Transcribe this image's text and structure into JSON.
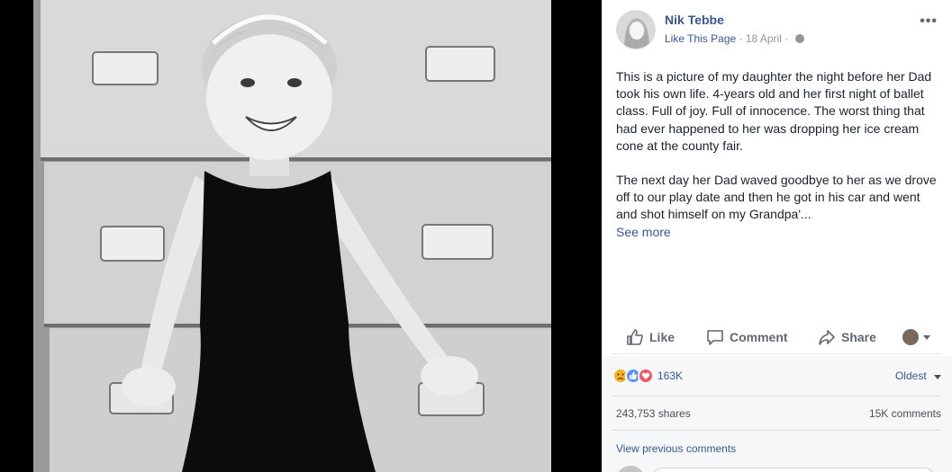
{
  "post": {
    "author": "Nik Tebbe",
    "like_page_label": "Like This Page",
    "separator": "·",
    "date": "18 April",
    "separator2": "·",
    "more_label": "•••",
    "paragraph1": "This is a picture of my daughter the night before her Dad took his own life. 4-years old and her first night of ballet class. Full of joy. Full of innocence. The worst thing that had ever happened to her was dropping her ice cream cone at the county fair.",
    "paragraph2": "The next day her Dad waved goodbye to her as we drove off to our play date and then he got in his car and went and shot himself on my Grandpa'...",
    "see_more": "See more"
  },
  "actions": {
    "like": "Like",
    "comment": "Comment",
    "share": "Share"
  },
  "stats": {
    "reaction_count": "163K",
    "sort_label": "Oldest",
    "shares": "243,753 shares",
    "comments": "15K comments",
    "view_previous": "View previous comments"
  },
  "colors": {
    "link": "#365899",
    "muted": "#90949c",
    "text": "#1d2129"
  },
  "icons": {
    "like": "thumbs-up-icon",
    "comment": "speech-bubble-icon",
    "share": "share-arrow-icon",
    "globe": "globe-icon",
    "sad": "sad-reaction-icon",
    "love": "love-reaction-icon"
  }
}
